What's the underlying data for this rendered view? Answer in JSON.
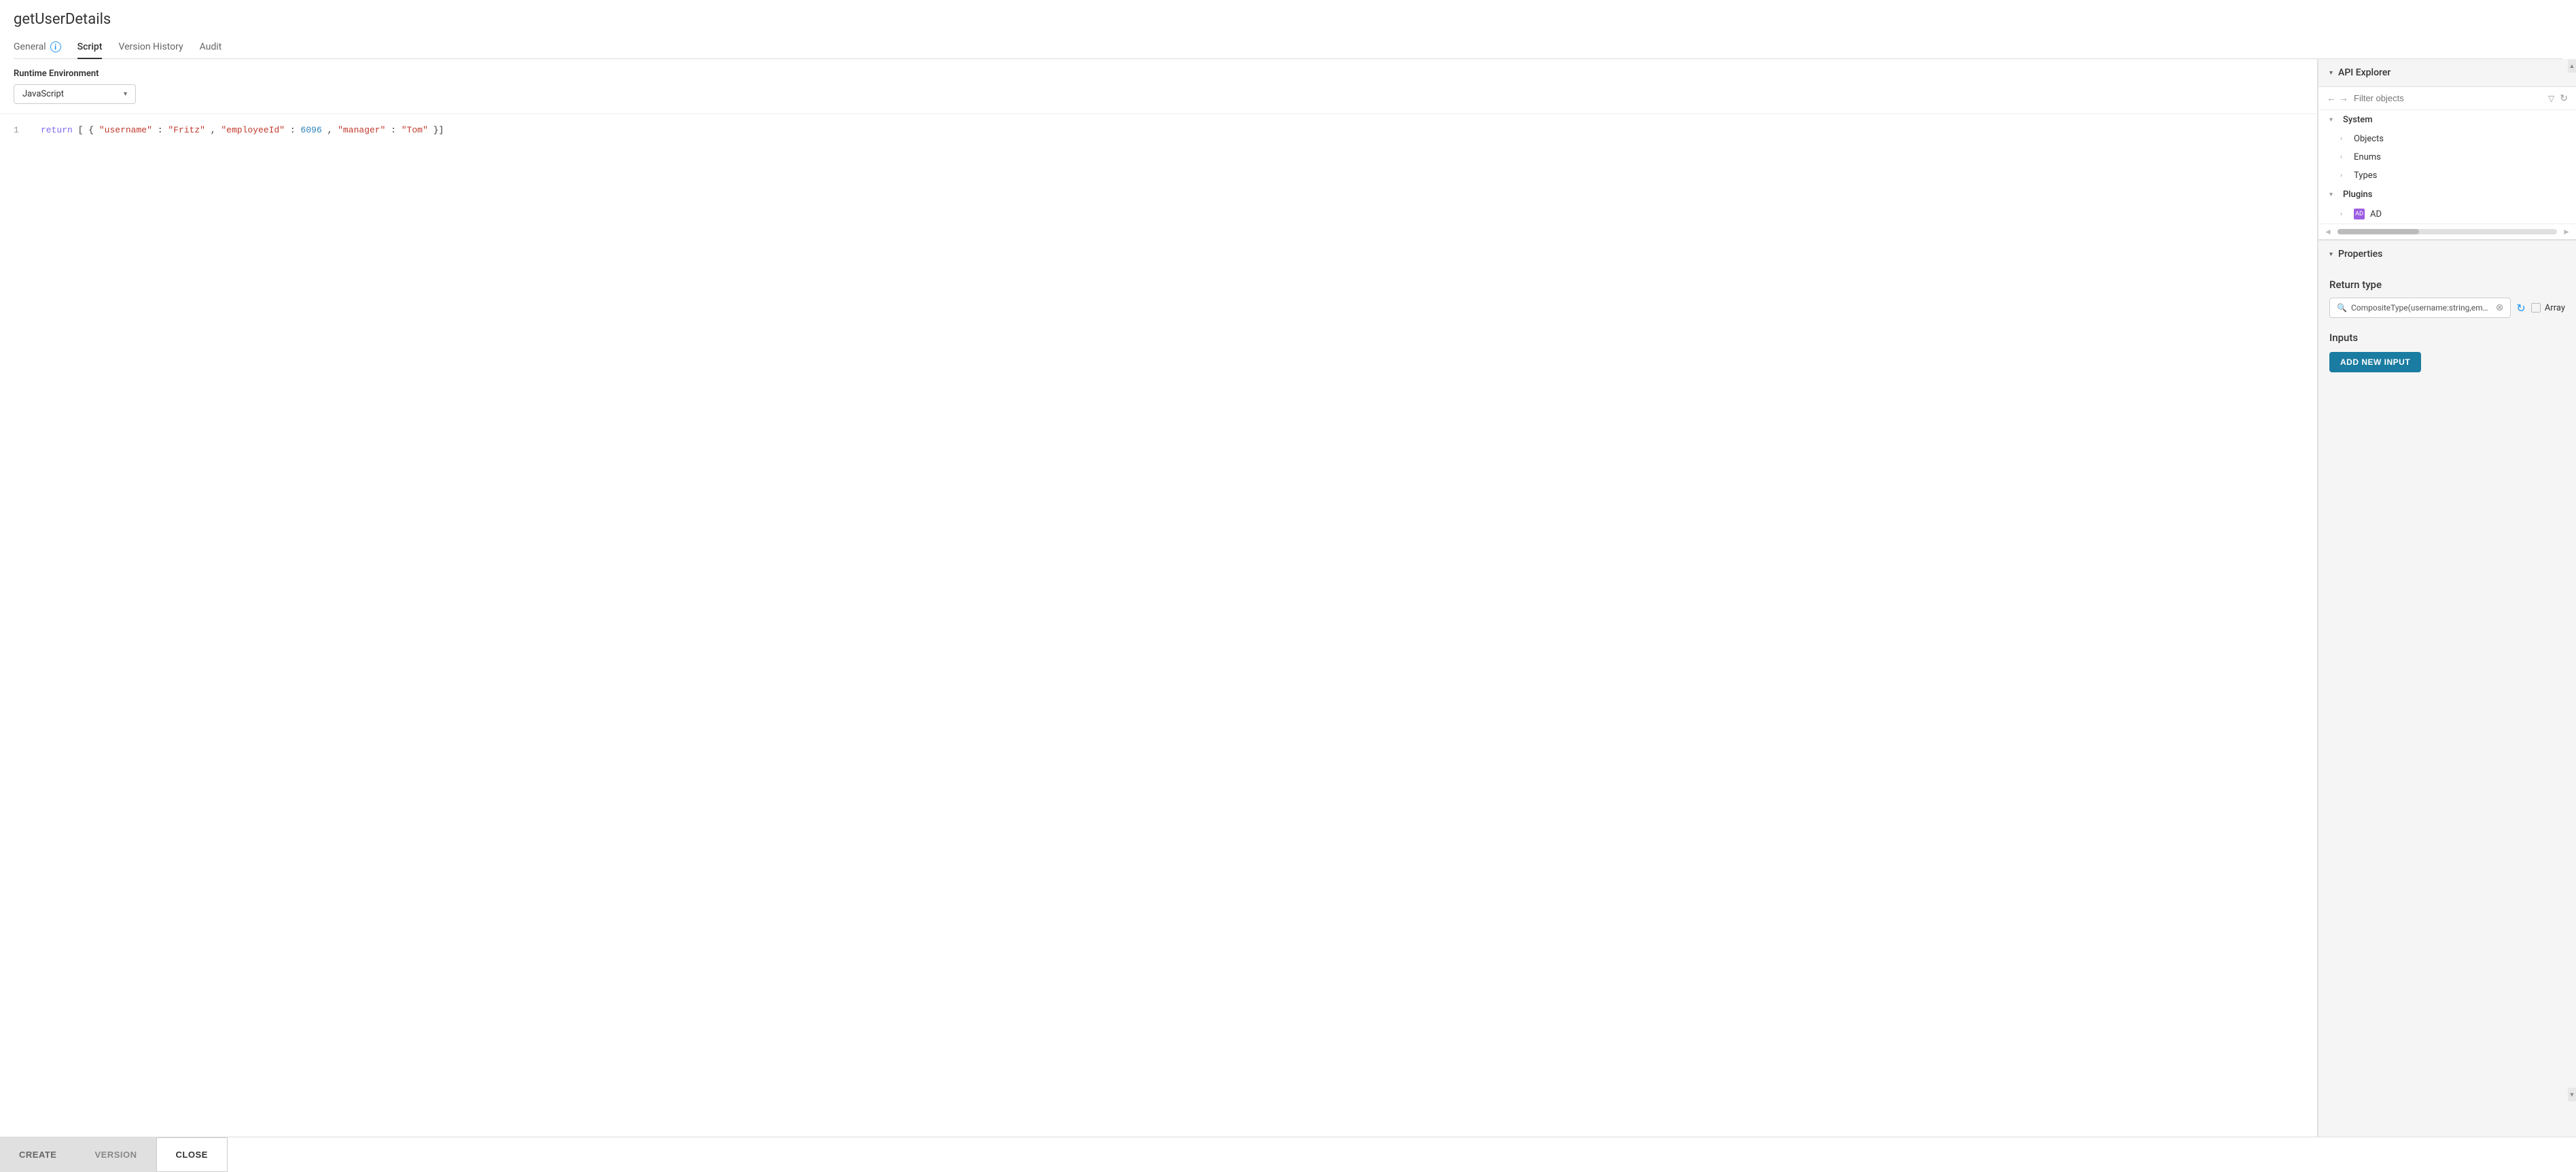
{
  "page": {
    "title": "getUserDetails",
    "tabs": [
      {
        "id": "general",
        "label": "General",
        "hasInfo": true,
        "active": false
      },
      {
        "id": "script",
        "label": "Script",
        "hasInfo": false,
        "active": true
      },
      {
        "id": "version-history",
        "label": "Version History",
        "hasInfo": false,
        "active": false
      },
      {
        "id": "audit",
        "label": "Audit",
        "hasInfo": false,
        "active": false
      }
    ]
  },
  "left_panel": {
    "runtime_env": {
      "label": "Runtime Environment",
      "value": "JavaScript"
    },
    "code": {
      "line_number": "1",
      "content": "return [{\"username\":\"Fritz\", \"employeeId\":6096,\"manager\":\"Tom\"}]"
    }
  },
  "right_panel": {
    "api_explorer": {
      "section_label": "API Explorer",
      "filter_placeholder": "Filter objects",
      "tree": [
        {
          "type": "section",
          "label": "System",
          "expanded": true,
          "indent": 0
        },
        {
          "type": "item",
          "label": "Objects",
          "indent": 1
        },
        {
          "type": "item",
          "label": "Enums",
          "indent": 1
        },
        {
          "type": "item",
          "label": "Types",
          "indent": 1
        },
        {
          "type": "section",
          "label": "Plugins",
          "expanded": true,
          "indent": 0
        },
        {
          "type": "item",
          "label": "AD",
          "indent": 1,
          "hasIcon": true
        }
      ]
    },
    "properties": {
      "section_label": "Properties",
      "return_type": {
        "label": "Return type",
        "value": "CompositeType(username:string,employeeId:number,manager:strin",
        "array_label": "Array"
      },
      "inputs": {
        "label": "Inputs",
        "add_button_label": "ADD NEW INPUT"
      }
    }
  },
  "bottom_bar": {
    "create_label": "CREATE",
    "version_label": "VERSION",
    "close_label": "CLOSE"
  }
}
